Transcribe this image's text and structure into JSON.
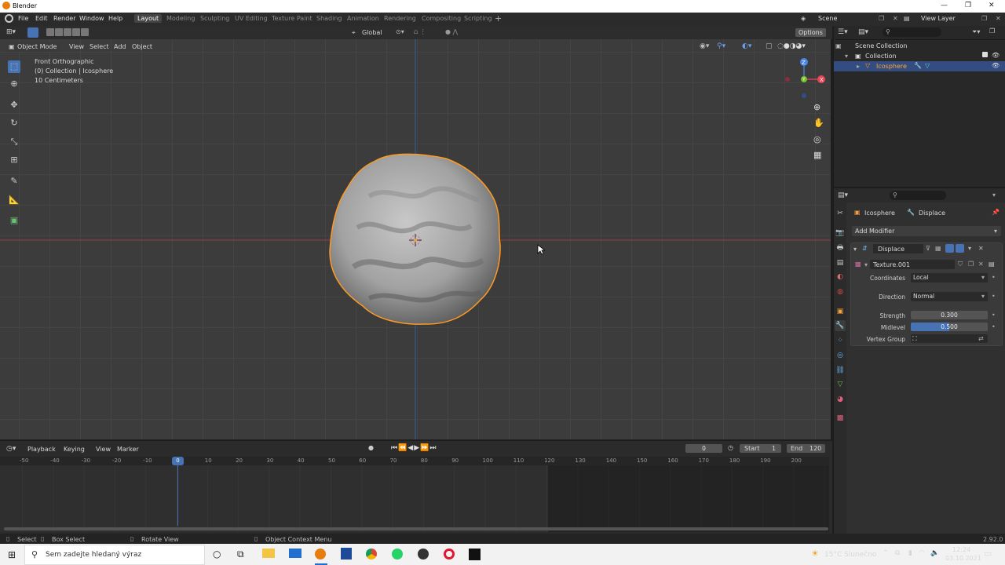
{
  "app": {
    "title": "Blender"
  },
  "menu": [
    "File",
    "Edit",
    "Render",
    "Window",
    "Help"
  ],
  "workspaces": [
    "Layout",
    "Modeling",
    "Sculpting",
    "UV Editing",
    "Texture Paint",
    "Shading",
    "Animation",
    "Rendering",
    "Compositing",
    "Scripting"
  ],
  "active_workspace": "Layout",
  "scene": {
    "name": "Scene",
    "view_layer": "View Layer"
  },
  "header3d": {
    "orientation": "Global",
    "options": "Options",
    "mode": "Object Mode",
    "menus": [
      "View",
      "Select",
      "Add",
      "Object"
    ]
  },
  "viewport": {
    "overlay_lines": [
      "Front Orthographic",
      "(0) Collection | Icosphere",
      "10 Centimeters"
    ],
    "background": "#3c3c3c",
    "x_axis_color": "#9c3c48",
    "z_axis_color": "#2f5f96"
  },
  "gizmo": {
    "z": "Z",
    "y": "Y",
    "x": "X"
  },
  "outliner": {
    "items": [
      "Scene Collection",
      "Collection",
      "Icosphere"
    ]
  },
  "properties": {
    "object": "Icosphere",
    "modifier_ref": "Displace",
    "add_modifier": "Add Modifier",
    "modifier": {
      "name": "Displace",
      "texture": "Texture.001",
      "coordinates_label": "Coordinates",
      "coordinates": "Local",
      "direction_label": "Direction",
      "direction": "Normal",
      "strength_label": "Strength",
      "strength": "0.300",
      "midlevel_label": "Midlevel",
      "midlevel": "0.500",
      "vertex_group_label": "Vertex Group"
    }
  },
  "timeline": {
    "menus": [
      "Playback",
      "Keying",
      "View",
      "Marker"
    ],
    "current_frame": "0",
    "start_label": "Start",
    "start": "1",
    "end_label": "End",
    "end": "120",
    "ticks": [
      "-50",
      "-40",
      "-30",
      "-20",
      "-10",
      "0",
      "10",
      "20",
      "30",
      "40",
      "50",
      "60",
      "70",
      "80",
      "90",
      "100",
      "110",
      "120",
      "130",
      "140",
      "150",
      "160",
      "170",
      "180",
      "190",
      "200"
    ]
  },
  "status": {
    "select": "Select",
    "box_select": "Box Select",
    "rotate_view": "Rotate View",
    "context_menu": "Object Context Menu",
    "version": "2.92.0"
  },
  "taskbar": {
    "search_placeholder": "Sem zadejte hledaný výraz",
    "weather": "15°C Slunečno",
    "time": "12:24",
    "date": "03.10.2021"
  },
  "colors": {
    "accent": "#4772b3",
    "selection": "#ff9a22",
    "header": "#2b2b2b"
  }
}
